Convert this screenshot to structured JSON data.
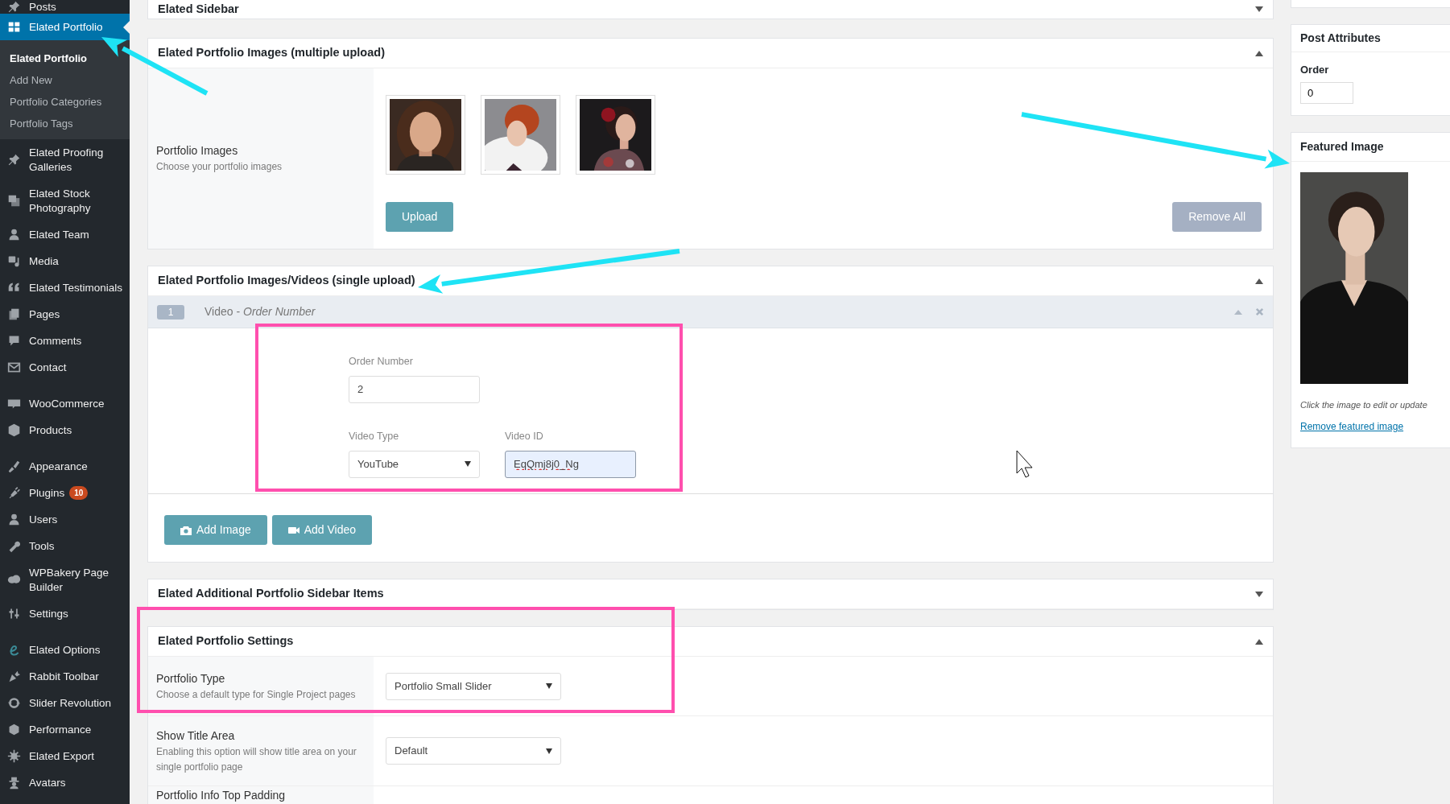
{
  "sidebar": {
    "groups": [
      [
        {
          "label": "Posts",
          "selected": false
        },
        {
          "label": "Elated Portfolio",
          "selected": true,
          "children": [
            {
              "label": "Elated Portfolio",
              "selected": true
            },
            {
              "label": "Add New",
              "selected": false
            },
            {
              "label": "Portfolio Categories",
              "selected": false
            },
            {
              "label": "Portfolio Tags",
              "selected": false
            }
          ]
        },
        {
          "label": "Elated Proofing Galleries",
          "selected": false
        },
        {
          "label": "Elated Stock Photography",
          "selected": false
        },
        {
          "label": "Elated Team",
          "selected": false
        },
        {
          "label": "Media",
          "selected": false
        },
        {
          "label": "Elated Testimonials",
          "selected": false
        },
        {
          "label": "Pages",
          "selected": false
        },
        {
          "label": "Comments",
          "selected": false
        },
        {
          "label": "Contact",
          "selected": false
        }
      ],
      [
        {
          "label": "WooCommerce",
          "selected": false
        },
        {
          "label": "Products",
          "selected": false
        }
      ],
      [
        {
          "label": "Appearance",
          "selected": false
        },
        {
          "label": "Plugins",
          "selected": false,
          "badge": "10"
        },
        {
          "label": "Users",
          "selected": false
        },
        {
          "label": "Tools",
          "selected": false
        },
        {
          "label": "WPBakery Page Builder",
          "selected": false
        },
        {
          "label": "Settings",
          "selected": false
        }
      ],
      [
        {
          "label": "Elated Options",
          "selected": false
        },
        {
          "label": "Rabbit Toolbar",
          "selected": false
        },
        {
          "label": "Slider Revolution",
          "selected": false
        },
        {
          "label": "Performance",
          "selected": false
        },
        {
          "label": "Elated Export",
          "selected": false
        },
        {
          "label": "Avatars",
          "selected": false
        }
      ]
    ]
  },
  "panels": [
    {
      "title": "Elated Sidebar",
      "expanded": false
    },
    {
      "kind": "gallery",
      "title": "Elated Portfolio Images (multiple upload)",
      "expanded": true,
      "label": "Portfolio Images",
      "description": "Choose your portfolio images",
      "images": [
        {
          "kind": "picture"
        },
        {
          "kind": "picture"
        },
        {
          "kind": "picture"
        }
      ],
      "buttons": [
        {
          "label": "Upload",
          "kind": "primary"
        },
        {
          "label": "Remove All",
          "kind": "secondary"
        }
      ]
    },
    {
      "kind": "items",
      "title": "Elated Portfolio Images/Videos (single upload)",
      "expanded": true,
      "item": {
        "number": "1",
        "title": "Video - *Order Number*",
        "fields": [
          {
            "label": "Order Number",
            "value": "2",
            "kind": "input",
            "focused": false,
            "spelling_error": false
          },
          {
            "label": "Video Type",
            "value": "YouTube",
            "kind": "select"
          },
          {
            "label": "Video ID",
            "value": "EqQmj8j0_Ng",
            "kind": "input",
            "focused": true,
            "spelling_error": true
          }
        ]
      },
      "buttons": [
        {
          "label": "Add Image"
        },
        {
          "label": "Add Video",
          "kind": "video"
        }
      ]
    },
    {
      "title": "Elated Additional Portfolio Sidebar Items",
      "expanded": false
    },
    {
      "kind": "settings",
      "title": "Elated Portfolio Settings",
      "expanded": true,
      "rows": [
        {
          "label": "Portfolio Type",
          "description": "Choose a default type for Single Project pages",
          "value": "Portfolio Small Slider"
        },
        {
          "label": "Show Title Area",
          "description": "Enabling this option will show title area on your single portfolio page",
          "value": "Default"
        },
        {
          "label": "Portfolio Info Top Padding"
        }
      ]
    }
  ],
  "post_attributes": {
    "title": "Post Attributes",
    "label": "Order",
    "value": "0"
  },
  "featured_image": {
    "title": "Featured Image",
    "image": {
      "kind": "picture"
    },
    "caption": "Click the image to edit or update",
    "link": "Remove featured image"
  },
  "annotations": [
    {
      "kind": "arrow",
      "color": "#1ee3f5"
    },
    {
      "kind": "arrow",
      "color": "#1ee3f5"
    },
    {
      "kind": "arrow",
      "color": "#1ee3f5"
    },
    {
      "kind": "frame",
      "color": "#ff4fae"
    },
    {
      "kind": "frame",
      "color": "#ff4fae"
    }
  ],
  "mouse_cursor": {
    "kind": "arrow"
  }
}
